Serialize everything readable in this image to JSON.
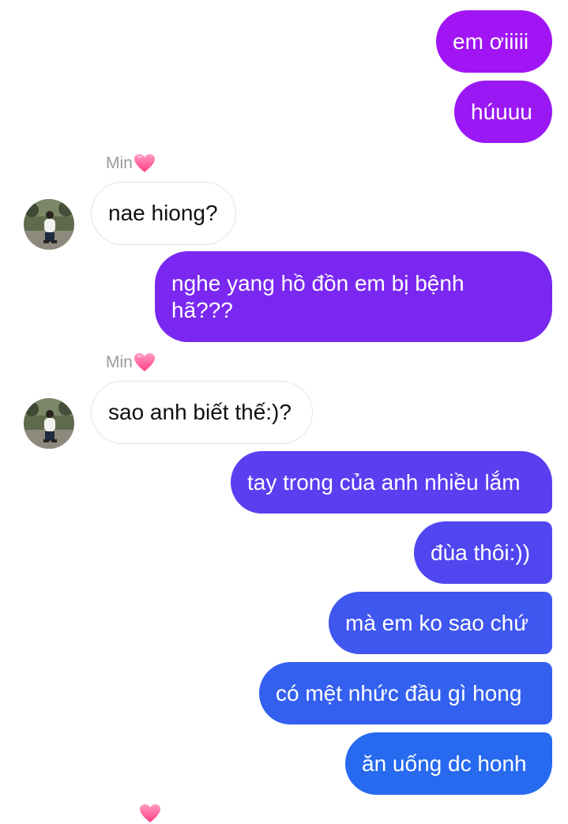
{
  "conversation": {
    "messages": [
      {
        "text": "em ơiiiii",
        "sender": "me"
      },
      {
        "text": "húuuu",
        "sender": "me"
      },
      {
        "sender_name": "Min",
        "text": "nae hiong?",
        "sender": "other"
      },
      {
        "text": "nghe yang hồ đồn em bị bệnh hã???",
        "sender": "me"
      },
      {
        "sender_name": "Min",
        "text": "sao anh biết thế:)?",
        "sender": "other"
      },
      {
        "text": "tay trong của anh nhiều lắm",
        "sender": "me"
      },
      {
        "text": "đùa thôi:))",
        "sender": "me"
      },
      {
        "text": "mà em ko sao chứ",
        "sender": "me"
      },
      {
        "text": "có mệt nhức đầu gì hong",
        "sender": "me"
      },
      {
        "text": "ăn uống dc honh",
        "sender": "me"
      }
    ]
  },
  "icons": {
    "sender_badge": "pink-heart-icon",
    "avatar": "contact-avatar"
  },
  "colors": {
    "outgoing_gradient_top": "#a115f5",
    "outgoing_gradient_bottom": "#1e6ff0",
    "incoming_bg": "#ffffff",
    "incoming_border": "#e4e4e4",
    "sender_name": "#9a9a9a",
    "heart": "#ff4f93"
  }
}
